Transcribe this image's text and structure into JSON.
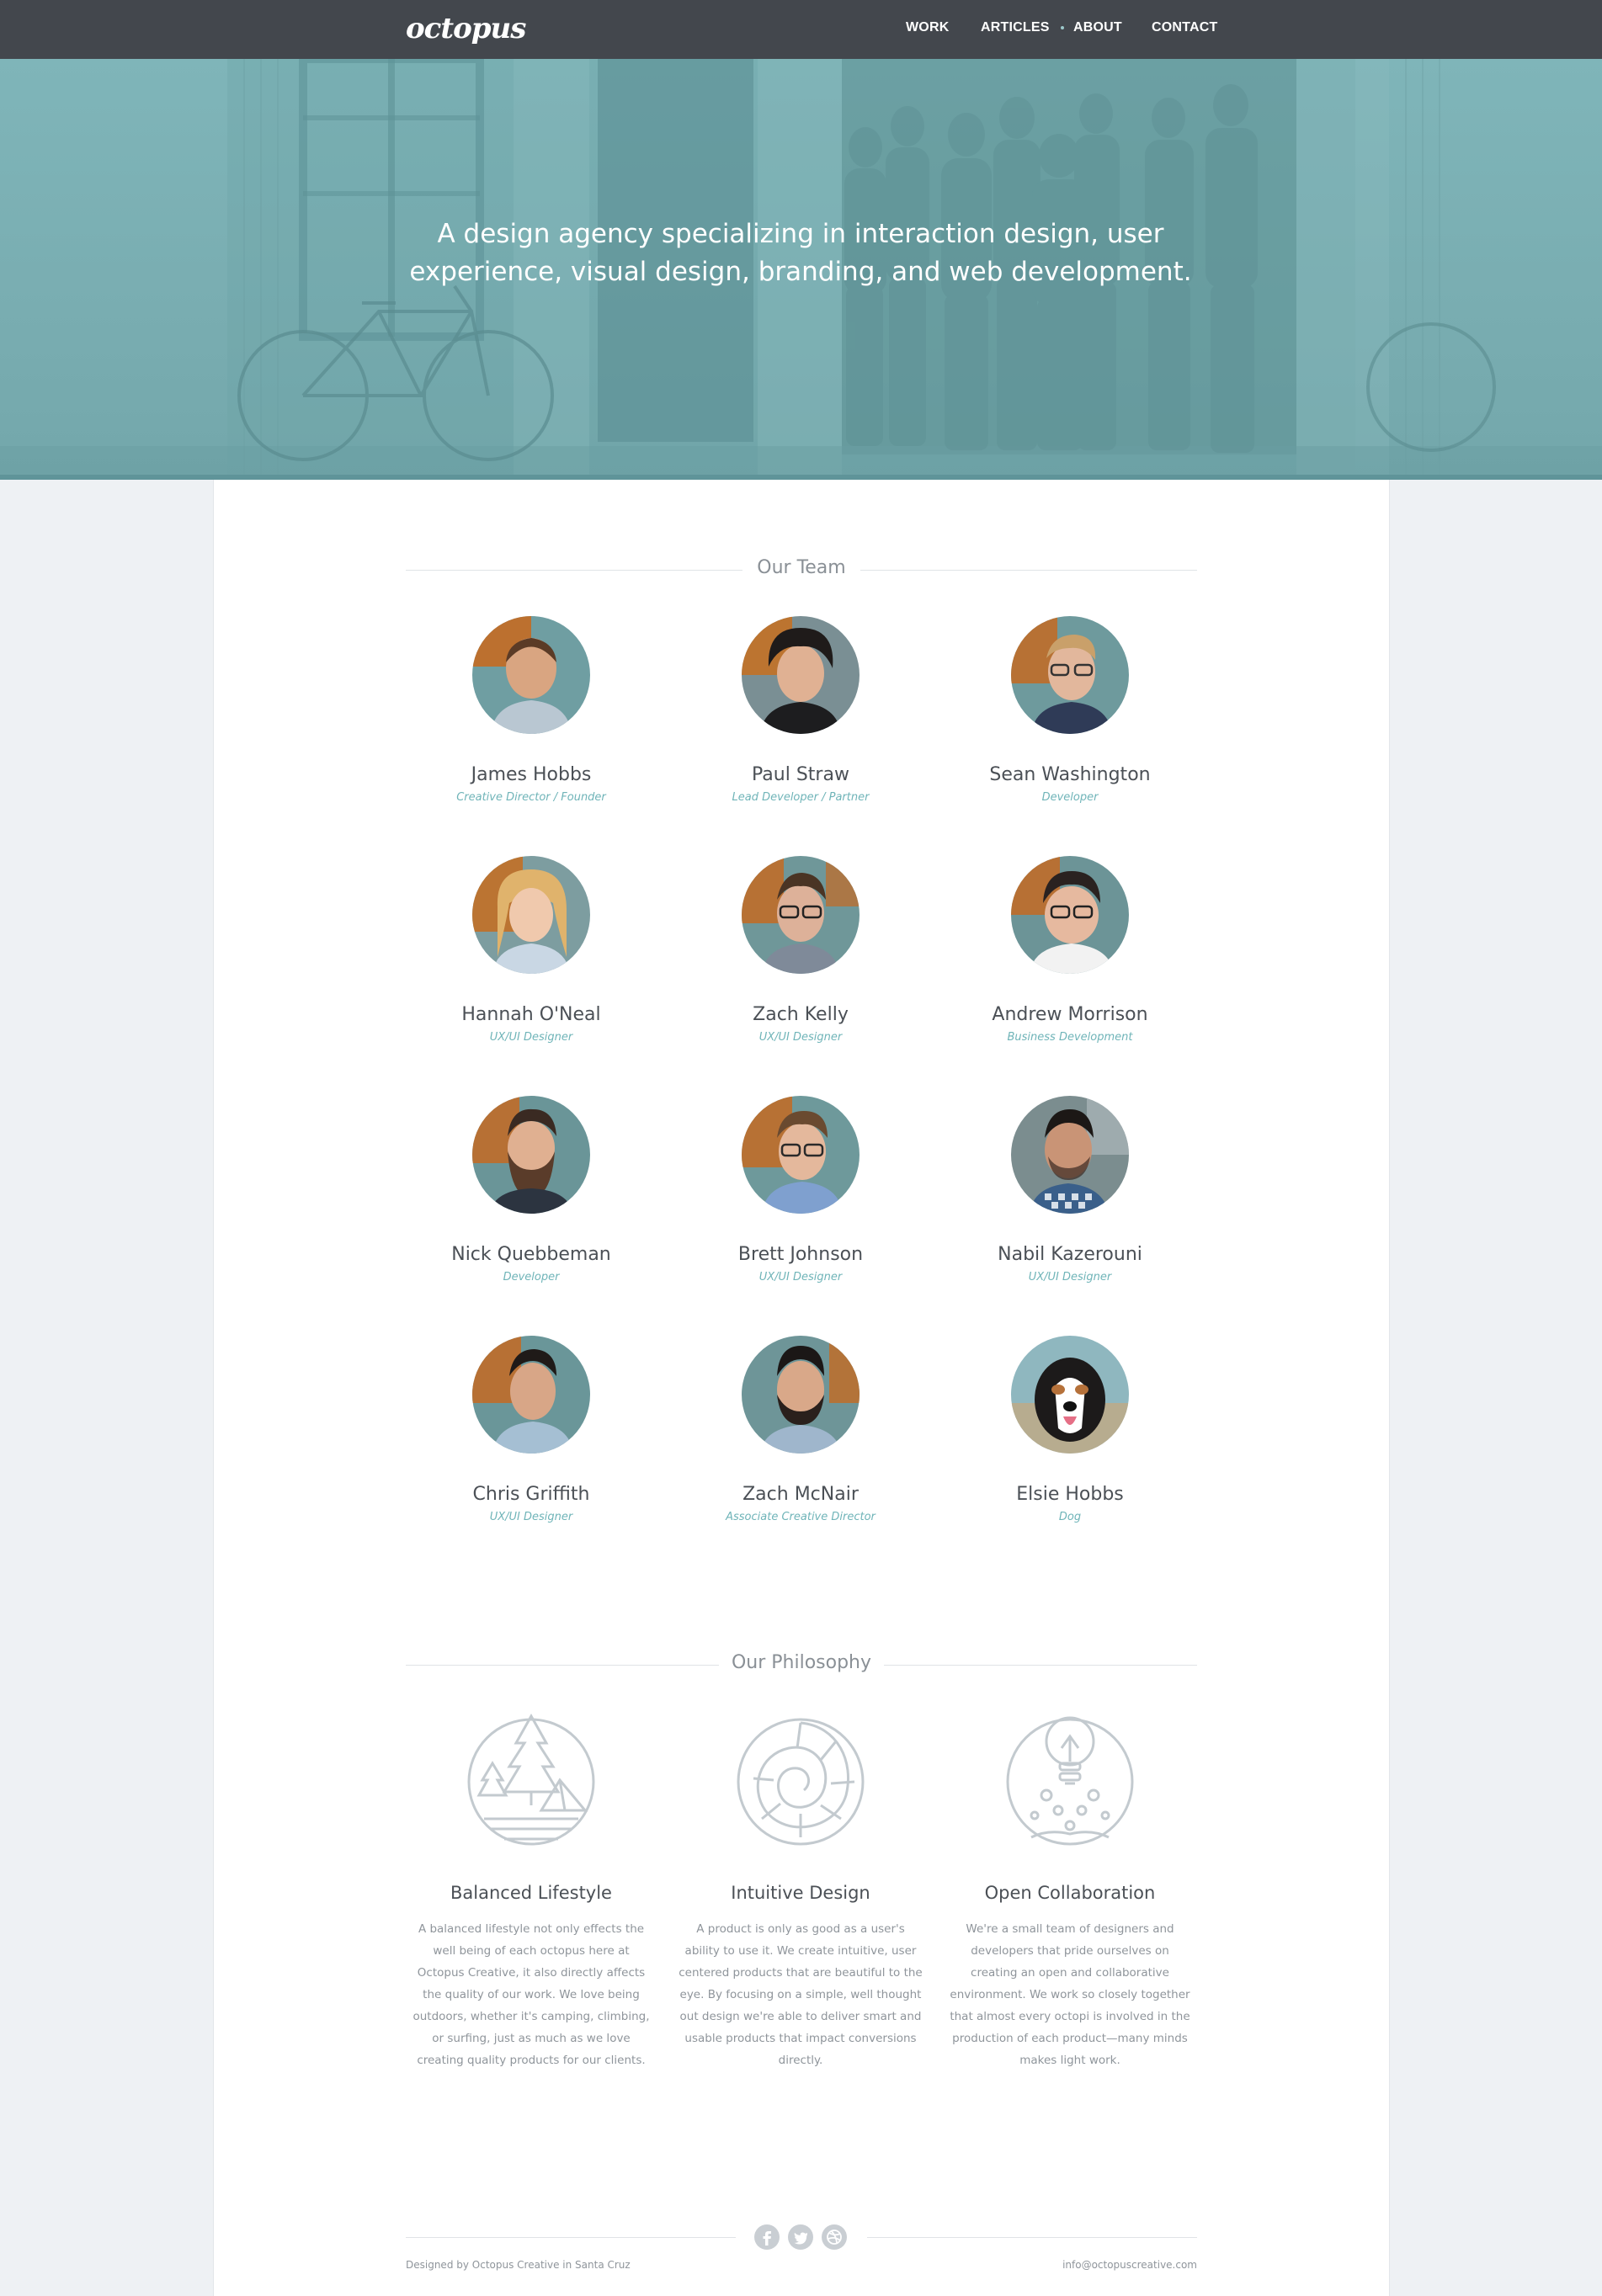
{
  "colors": {
    "nav_bg": "#43474d",
    "hero_teal": "#7fb5b9",
    "accent": "#6fb4b8",
    "page_bg": "#eef1f4"
  },
  "nav": {
    "logo": "octopus",
    "links": [
      "Work",
      "Articles",
      "About",
      "Contact"
    ],
    "active": "About"
  },
  "hero": {
    "tagline": "A design agency specializing in interaction design, user experience, visual design, branding, and web development."
  },
  "team": {
    "title": "Our Team",
    "members": [
      {
        "name": "James Hobbs",
        "role": "Creative Director / Founder"
      },
      {
        "name": "Paul Straw",
        "role": "Lead Developer / Partner"
      },
      {
        "name": "Sean Washington",
        "role": "Developer"
      },
      {
        "name": "Hannah O'Neal",
        "role": "UX/UI Designer"
      },
      {
        "name": "Zach Kelly",
        "role": "UX/UI Designer"
      },
      {
        "name": "Andrew Morrison",
        "role": "Business Development"
      },
      {
        "name": "Nick Quebbeman",
        "role": "Developer"
      },
      {
        "name": "Brett Johnson",
        "role": "UX/UI Designer"
      },
      {
        "name": "Nabil Kazerouni",
        "role": "UX/UI Designer"
      },
      {
        "name": "Chris Griffith",
        "role": "UX/UI Designer"
      },
      {
        "name": "Zach McNair",
        "role": "Associate Creative Director"
      },
      {
        "name": "Elsie Hobbs",
        "role": "Dog"
      }
    ]
  },
  "philosophy": {
    "title": "Our Philosophy",
    "items": [
      {
        "title": "Balanced Lifestyle",
        "text": "A balanced lifestyle not only effects the well being of each octopus here at Octopus Creative, it also directly affects the quality of our work. We love being outdoors, whether it's camping, climbing, or surfing, just as much as we love creating quality products for our clients.",
        "icon": "campsite-icon"
      },
      {
        "title": "Intuitive Design",
        "text": "A product is only as good as a user's ability to use it. We create intuitive, user centered products that are beautiful to the eye. By focusing on a simple, well thought out design we're able to deliver smart and usable products that impact conversions directly.",
        "icon": "nautilus-shell-icon"
      },
      {
        "title": "Open Collaboration",
        "text": "We're a small team of designers and developers that pride ourselves on creating an open and collaborative environment. We work so closely together that almost every octopi is involved in the production of each product—many minds makes light work.",
        "icon": "lightbulb-octopus-icon"
      }
    ]
  },
  "footer": {
    "credit": "Designed by Octopus Creative in Santa Cruz",
    "email": "info@octopuscreative.com",
    "social": [
      "facebook-icon",
      "twitter-icon",
      "dribbble-icon"
    ]
  }
}
